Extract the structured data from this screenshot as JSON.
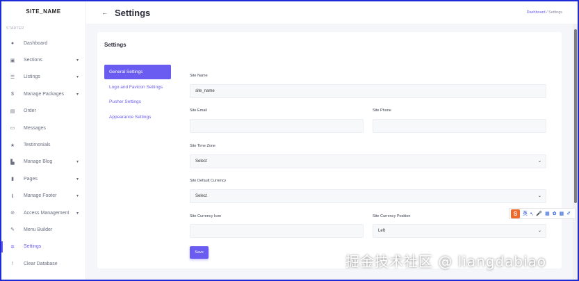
{
  "sidebar": {
    "brand": "SITE_NAME",
    "section_label": "STARTER",
    "items": [
      {
        "label": "Dashboard",
        "icon": "dashboard-icon",
        "glyph": "●",
        "caret": false,
        "active": false
      },
      {
        "label": "Sections",
        "icon": "sections-icon",
        "glyph": "▣",
        "caret": true,
        "active": false
      },
      {
        "label": "Listings",
        "icon": "listings-icon",
        "glyph": "☰",
        "caret": true,
        "active": false
      },
      {
        "label": "Manage Packages",
        "icon": "dollar-icon",
        "glyph": "$",
        "caret": true,
        "active": false
      },
      {
        "label": "Order",
        "icon": "cart-icon",
        "glyph": "▤",
        "caret": false,
        "active": false
      },
      {
        "label": "Messages",
        "icon": "inbox-icon",
        "glyph": "▭",
        "caret": false,
        "active": false
      },
      {
        "label": "Testimonials",
        "icon": "star-icon",
        "glyph": "★",
        "caret": false,
        "active": false
      },
      {
        "label": "Manage Blog",
        "icon": "blog-icon",
        "glyph": "▙",
        "caret": true,
        "active": false
      },
      {
        "label": "Pages",
        "icon": "pages-icon",
        "glyph": "▮",
        "caret": true,
        "active": false
      },
      {
        "label": "Manage Footer",
        "icon": "info-icon",
        "glyph": "ℹ",
        "caret": true,
        "active": false
      },
      {
        "label": "Access Management",
        "icon": "ban-icon",
        "glyph": "⊘",
        "caret": true,
        "active": false
      },
      {
        "label": "Menu Builder",
        "icon": "wrench-icon",
        "glyph": "✎",
        "caret": false,
        "active": false
      },
      {
        "label": "Settings",
        "icon": "gear-icon",
        "glyph": "✲",
        "caret": false,
        "active": true
      },
      {
        "label": "Clear Database",
        "icon": "exclamation-icon",
        "glyph": "!",
        "caret": false,
        "active": false
      }
    ]
  },
  "header": {
    "back_icon": "arrow-left-icon",
    "back_glyph": "←",
    "title": "Settings",
    "breadcrumb": {
      "link": "Dashboard",
      "separator": "/",
      "current": "Settings"
    }
  },
  "card": {
    "title": "Settings",
    "tabs": [
      {
        "label": "General Settings",
        "active": true
      },
      {
        "label": "Logo and Favicon Settings",
        "active": false
      },
      {
        "label": "Pusher Settings",
        "active": false
      },
      {
        "label": "Appearance Settings",
        "active": false
      }
    ],
    "form": {
      "site_name": {
        "label": "Site Name",
        "value": "site_name"
      },
      "site_email": {
        "label": "Site Email",
        "value": ""
      },
      "site_phone": {
        "label": "Site Phone",
        "value": ""
      },
      "site_time_zone": {
        "label": "Site Time Zone",
        "value": "Select"
      },
      "site_default_currency": {
        "label": "Site Default Currency",
        "value": "Select"
      },
      "site_currency_icon": {
        "label": "Site Currency Icon",
        "value": ""
      },
      "site_currency_position": {
        "label": "Site Currency Position",
        "value": "Left"
      },
      "chevron_glyph": "⌄",
      "save_label": "Save"
    }
  },
  "ime_toolbar": {
    "logo": "S",
    "items": [
      "英",
      "•,",
      "🎤",
      "▦",
      "✿",
      "▩",
      "✐"
    ]
  },
  "watermark": "掘金技术社区 @ liangdabiao",
  "colors": {
    "accent": "#6a5cf0",
    "frame": "#1d2bd6"
  }
}
